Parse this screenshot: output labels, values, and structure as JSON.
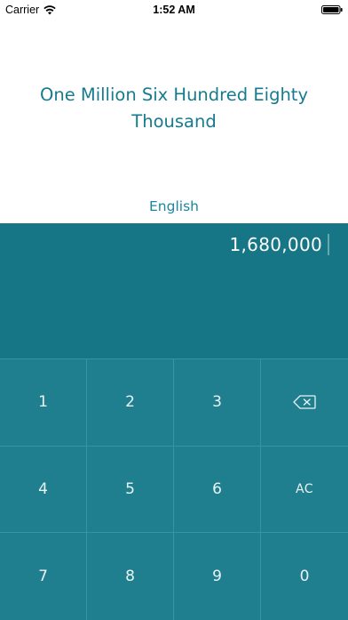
{
  "status_bar": {
    "carrier": "Carrier",
    "time": "1:52 AM"
  },
  "result": {
    "words": "One Million Six Hundred Eighty Thousand"
  },
  "language": {
    "label": "English"
  },
  "input": {
    "value": "1,680,000"
  },
  "keypad": {
    "keys": [
      "1",
      "2",
      "3",
      "backspace",
      "4",
      "5",
      "6",
      "AC",
      "7",
      "8",
      "9",
      "0"
    ]
  },
  "colors": {
    "accent_text": "#167b8f",
    "display_background": "#167685",
    "keypad_background": "#207f8f",
    "keypad_divider": "#3a93a1"
  }
}
